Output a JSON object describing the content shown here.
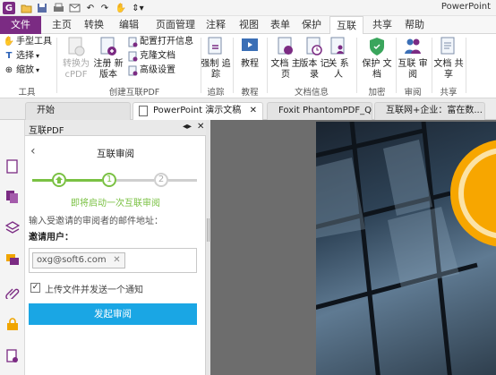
{
  "window": {
    "title": "PowerPoint"
  },
  "menu": {
    "tabs": [
      "文件",
      "主页",
      "转换",
      "编辑",
      "页面管理",
      "注释",
      "视图",
      "表单",
      "保护",
      "互联",
      "共享",
      "帮助"
    ]
  },
  "ribbon": {
    "tools": {
      "hand": "手型工具",
      "select": "选择",
      "zoom": "缩放",
      "group": "工具"
    },
    "create": {
      "convert": "转换为 cPDF",
      "register": "注册 新版本",
      "config": "配置打开信息",
      "clone": "克隆文档",
      "advanced": "高级设置",
      "group": "创建互联PDF"
    },
    "tracking": {
      "track": "强制 追踪",
      "group": "追踪"
    },
    "tutorial": {
      "tutorial": "教程",
      "group": "教程"
    },
    "docinfo": {
      "home": "文档 主页",
      "versions": "版本 记录",
      "contacts": "关 系人",
      "group": "文档信息"
    },
    "encrypt": {
      "protect": "保护 文档",
      "group": "加密"
    },
    "review": {
      "review": "互联 审阅",
      "group": "审阅"
    },
    "share": {
      "share": "文档 共享",
      "group": "共享"
    }
  },
  "doc_tabs": [
    {
      "label": "开始"
    },
    {
      "label": "PowerPoint 演示文稿"
    },
    {
      "label": "Foxit PhantomPDF_Qui..."
    },
    {
      "label": "互联网+企业：富在数..."
    }
  ],
  "panel": {
    "header": "互联PDF",
    "title": "互联审阅",
    "steps": [
      "1",
      "2"
    ],
    "step_caption": "即将启动一次互联审阅",
    "instruction": "输入受邀请的审阅者的邮件地址：",
    "invite_label": "邀请用户：",
    "email_chip": "oxg@soft6.com",
    "checkbox_label": "上传文件并发送一个通知",
    "submit": "发起审阅"
  },
  "colors": {
    "brand": "#7b2b83",
    "step_green": "#7ac143",
    "submit_blue": "#1aa6e4",
    "accent_orange": "#f7a600"
  }
}
